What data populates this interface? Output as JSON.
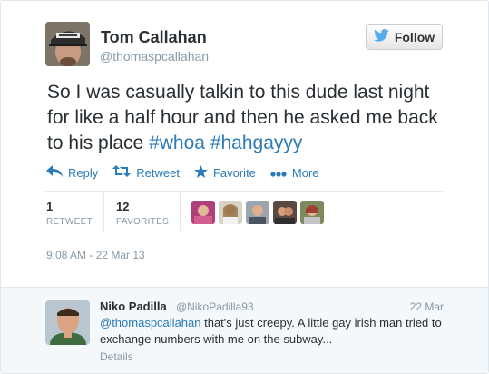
{
  "tweet": {
    "author": {
      "display_name": "Tom Callahan",
      "handle": "@thomaspcallahan"
    },
    "follow_label": "Follow",
    "text_plain": "So I was casually talkin to this dude last night for like a half hour and then he asked me back to his place",
    "hashtags": [
      "#whoa",
      "#hahgayyy"
    ],
    "actions": {
      "reply": "Reply",
      "retweet": "Retweet",
      "favorite": "Favorite",
      "more": "More"
    },
    "stats": {
      "retweets": "1",
      "retweets_label": "RETWEET",
      "favorites": "12",
      "favorites_label": "FAVORITES"
    },
    "timestamp": "9:08 AM - 22 Mar 13",
    "favoriter_count_shown": 5
  },
  "reply": {
    "author": {
      "display_name": "Niko Padilla",
      "handle": "@NikoPadilla93"
    },
    "date": "22 Mar",
    "mention": "@thomaspcallahan",
    "text": " that's just creepy. A little gay irish man tried to exchange numbers with me on the subway...",
    "details_label": "Details"
  },
  "colors": {
    "link_blue": "#2b7bb9",
    "muted_gray": "#8899a6",
    "text_dark": "#292f33",
    "reply_bg": "#f5f8fa",
    "twitter_bird": "#55acee"
  },
  "icons": {
    "follow": "twitter-bird-icon",
    "reply": "reply-arrow-icon",
    "retweet": "retweet-icon",
    "favorite": "star-icon",
    "more": "ellipsis-icon"
  }
}
